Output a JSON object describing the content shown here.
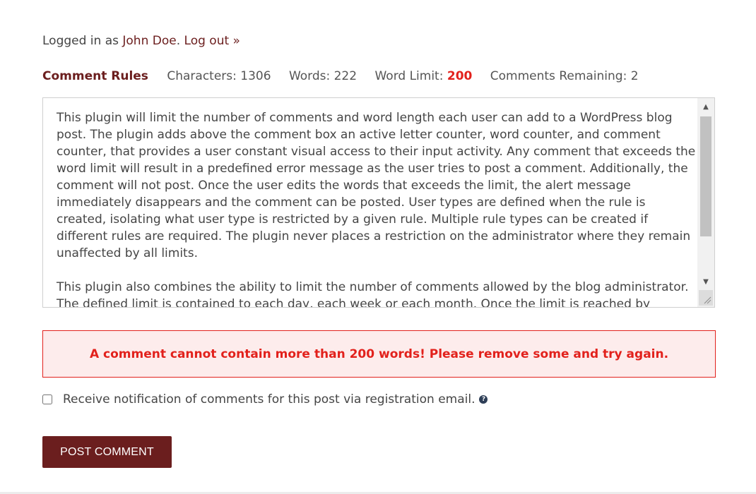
{
  "account": {
    "prefix": "Logged in as ",
    "user_name": "John Doe",
    "separator": ". ",
    "logout_label": "Log out »"
  },
  "rules": {
    "title": "Comment Rules",
    "characters": "Characters: 1306",
    "words": "Words: 222",
    "word_limit_label": "Word Limit: ",
    "word_limit_value": "200",
    "comments_remaining": "Comments Remaining: 2"
  },
  "comment": {
    "text": "This plugin will limit the number of comments and word length each user can add to a WordPress blog post. The plugin adds above the comment box an active letter counter, word counter, and comment counter, that provides a user constant visual access to their input activity. Any comment that exceeds the word limit will result in a predefined error message as the user tries to post a comment. Additionally, the comment will not post. Once the user edits the words that exceeds the limit, the alert message immediately disappears and the comment can be posted. User types are defined when the rule is created, isolating what user type is restricted by a given rule. Multiple rule types can be created if different rules are required. The plugin never places a restriction on the administrator where they remain unaffected by all limits.\n\nThis plugin also combines the ability to limit the number of comments allowed by the blog administrator. The defined limit is contained to each day, each week or each month. Once the limit is reached by"
  },
  "error": {
    "message": "A comment cannot contain more than 200 words! Please remove some and try again."
  },
  "notify": {
    "label": "Receive notification of comments for this post via registration email.",
    "help_glyph": "?"
  },
  "submit": {
    "label": "POST COMMENT"
  },
  "colors": {
    "brand": "#6b1e1e",
    "error": "#e2211c",
    "error_bg": "#fdecec"
  }
}
